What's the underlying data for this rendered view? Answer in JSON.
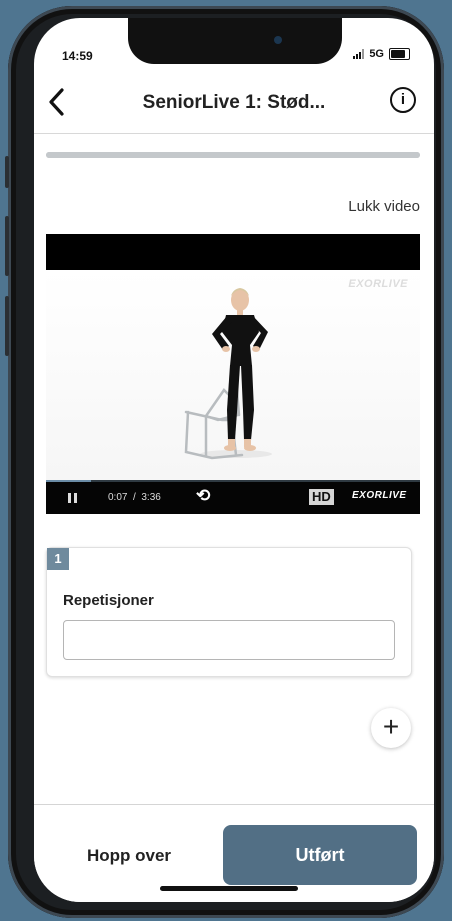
{
  "status_bar": {
    "time": "14:59",
    "network": "5G"
  },
  "header": {
    "back_icon": "chevron-left-icon",
    "title": "SeniorLive 1: Stød...",
    "info_icon": "info-icon"
  },
  "progress": {
    "fraction": 1.0
  },
  "video": {
    "close_label": "Lukk video",
    "watermark": "EXORLIVE",
    "current_time": "0:07",
    "separator": "/",
    "duration": "3:36",
    "hd_label": "HD",
    "brand": "EXORLIVE",
    "playback_fraction": 0.12
  },
  "exercise_card": {
    "set_number": "1",
    "field_label": "Repetisjoner",
    "field_value": ""
  },
  "add_set": {
    "label": "+"
  },
  "footer": {
    "skip_label": "Hopp over",
    "done_label": "Utført"
  },
  "colors": {
    "accent": "#526f85",
    "badge": "#6f8a9d",
    "background": "#4f7590"
  }
}
